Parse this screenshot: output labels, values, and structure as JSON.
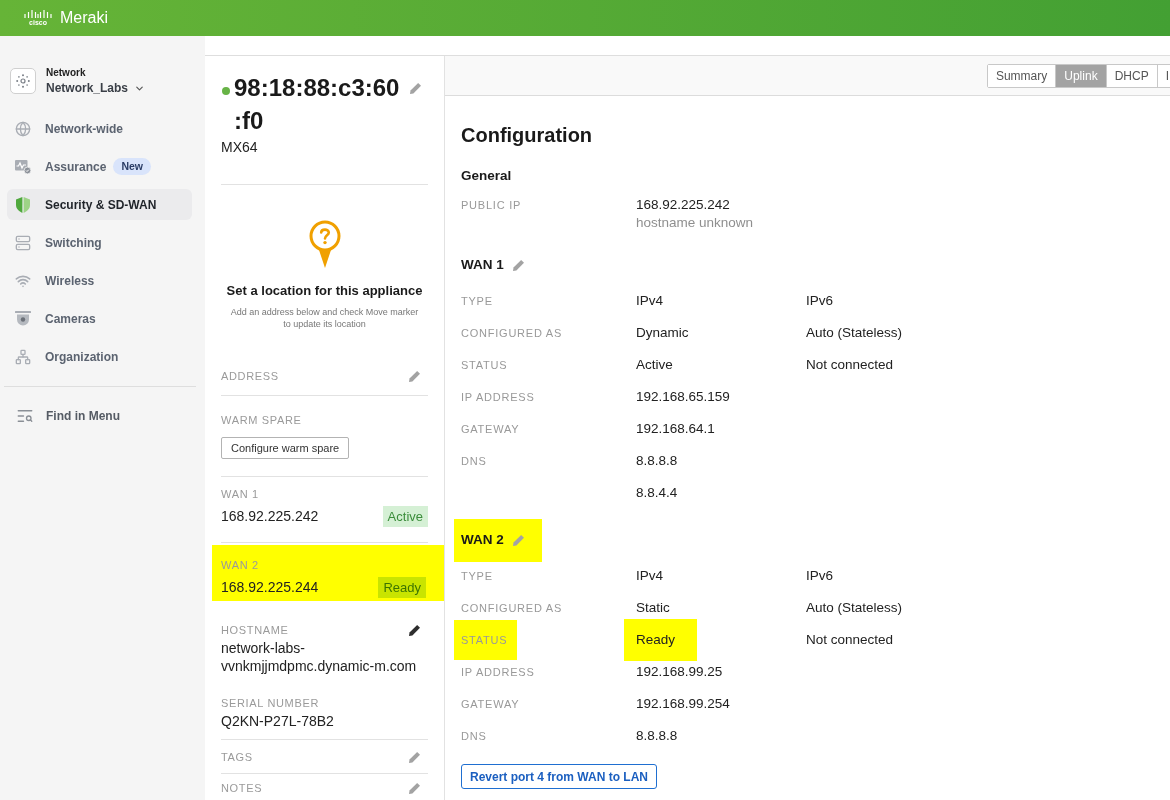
{
  "topbar": {
    "logo": "cisco",
    "product": "Meraki"
  },
  "sidebar": {
    "network": {
      "caption": "Network",
      "name": "Network_Labs"
    },
    "items": [
      {
        "label": "Network-wide",
        "selected": false
      },
      {
        "label": "Assurance",
        "selected": false,
        "badge": "New"
      },
      {
        "label": "Security & SD-WAN",
        "selected": true
      },
      {
        "label": "Switching",
        "selected": false
      },
      {
        "label": "Wireless",
        "selected": false
      },
      {
        "label": "Cameras",
        "selected": false
      },
      {
        "label": "Organization",
        "selected": false
      }
    ],
    "find": "Find in Menu"
  },
  "device": {
    "online": true,
    "name": "98:18:88:c3:60:f0",
    "model": "MX64",
    "location": {
      "title": "Set a location for this appliance",
      "hint": "Add an address below and check Move marker to update its location"
    },
    "address_label": "ADDRESS",
    "warm_spare": {
      "label": "WARM SPARE",
      "button": "Configure warm spare"
    },
    "wan": [
      {
        "label": "WAN 1",
        "ip": "168.92.225.242",
        "status": "Active",
        "highlighted": false
      },
      {
        "label": "WAN 2",
        "ip": "168.92.225.244",
        "status": "Ready",
        "highlighted": true
      }
    ],
    "hostname": {
      "label": "HOSTNAME",
      "value": "network-labs-vvnkmjjmdpmc.dynamic-m.com"
    },
    "serial": {
      "label": "SERIAL NUMBER",
      "value": "Q2KN-P27L-78B2"
    },
    "tags_label": "TAGS",
    "notes_label": "NOTES"
  },
  "tabs": [
    {
      "label": "Summary",
      "selected": false
    },
    {
      "label": "Uplink",
      "selected": true
    },
    {
      "label": "DHCP",
      "selected": false
    },
    {
      "label": "I",
      "selected": false
    }
  ],
  "configuration": {
    "title": "Configuration",
    "general": {
      "heading": "General",
      "label": "PUBLIC IP",
      "value": "168.92.225.242",
      "note": "hostname unknown"
    },
    "wans": [
      {
        "heading": "WAN 1",
        "highlighted": false,
        "rows": [
          {
            "label": "TYPE",
            "ipv4": "IPv4",
            "ipv6": "IPv6",
            "highlighted": false
          },
          {
            "label": "CONFIGURED AS",
            "ipv4": "Dynamic",
            "ipv6": "Auto (Stateless)",
            "highlighted": false
          },
          {
            "label": "STATUS",
            "ipv4": "Active",
            "ipv6": "Not connected",
            "highlighted": false
          },
          {
            "label": "IP ADDRESS",
            "ipv4": "192.168.65.159",
            "highlighted": false
          },
          {
            "label": "GATEWAY",
            "ipv4": "192.168.64.1",
            "highlighted": false
          },
          {
            "label": "DNS",
            "ipv4": "8.8.8.8",
            "highlighted": false
          },
          {
            "ipv4": "8.8.4.4",
            "highlighted": false
          }
        ]
      },
      {
        "heading": "WAN 2",
        "highlighted": true,
        "rows": [
          {
            "label": "TYPE",
            "ipv4": "IPv4",
            "ipv6": "IPv6",
            "highlighted": false
          },
          {
            "label": "CONFIGURED AS",
            "ipv4": "Static",
            "ipv6": "Auto (Stateless)",
            "highlighted": false
          },
          {
            "label": "STATUS",
            "ipv4": "Ready",
            "ipv6": "Not connected",
            "highlighted": true
          },
          {
            "label": "IP ADDRESS",
            "ipv4": "192.168.99.25",
            "highlighted": false
          },
          {
            "label": "GATEWAY",
            "ipv4": "192.168.99.254",
            "highlighted": false
          },
          {
            "label": "DNS",
            "ipv4": "8.8.8.8",
            "highlighted": false
          }
        ]
      }
    ],
    "button": "Revert port 4 from WAN to LAN"
  }
}
